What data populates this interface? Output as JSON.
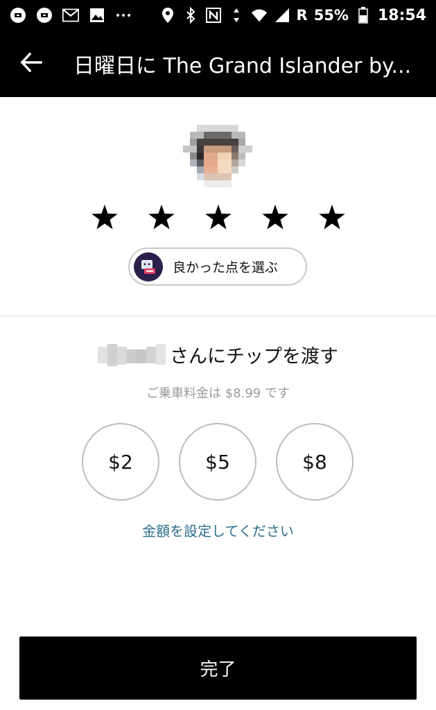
{
  "status_bar": {
    "carrier_indicator": "R",
    "battery_percent": "55%",
    "time": "18:54",
    "icons": [
      "uber-icon",
      "uber-icon",
      "gmail-icon",
      "image-icon",
      "more-dots-icon",
      "location-icon",
      "bluetooth-icon",
      "nfc-icon",
      "data-arrows-icon",
      "wifi-icon",
      "signal-icon",
      "battery-icon"
    ]
  },
  "app_bar": {
    "title": "日曜日に The Grand Islander by..."
  },
  "rating": {
    "stars": 5,
    "compliment_label": "良かった点を選ぶ"
  },
  "tip": {
    "heading": "さんにチップを渡す",
    "fare_note": "ご乗車料金は $8.99 です",
    "options": [
      {
        "label": "$2"
      },
      {
        "label": "$5"
      },
      {
        "label": "$8"
      }
    ],
    "custom_label": "金額を設定してください"
  },
  "footer": {
    "done_label": "完了"
  },
  "colors": {
    "link": "#2f6e8e",
    "muted": "#9a9a9a",
    "compliment_icon_bg": "#2b1e4a"
  }
}
